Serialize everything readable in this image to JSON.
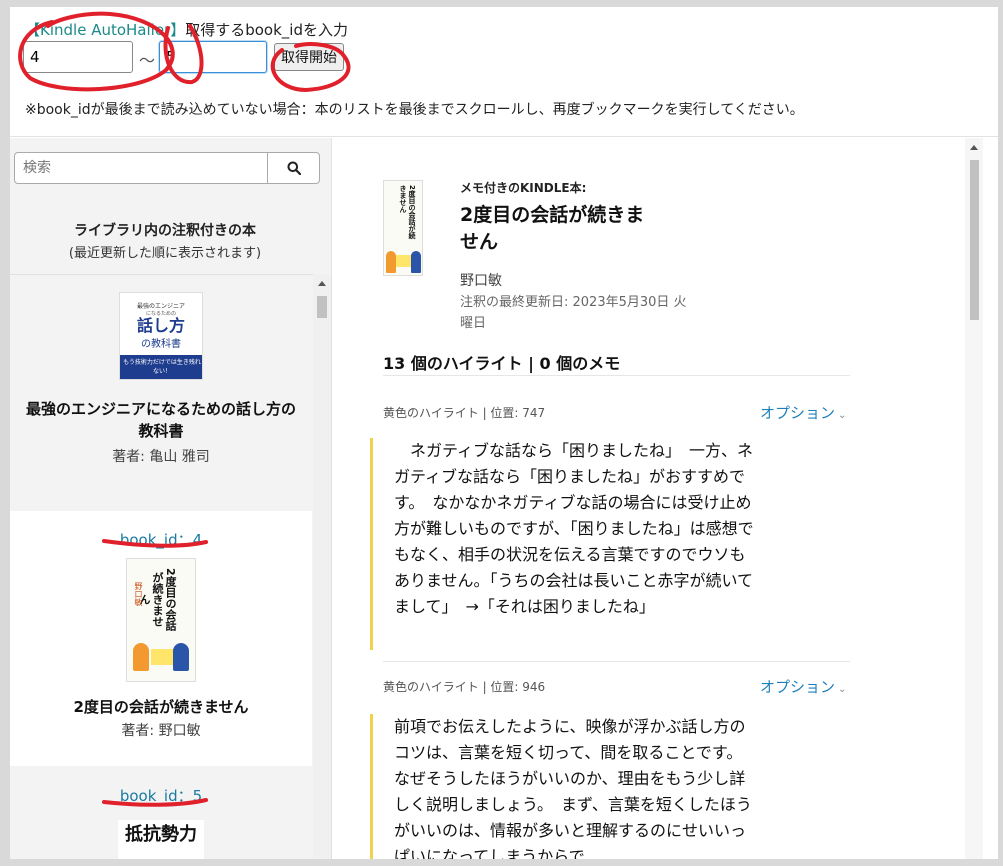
{
  "top": {
    "app_name": "【Kindle AutoHailer】",
    "prompt": "取得するbook_idを入力",
    "from_value": "4",
    "separator": "〜",
    "to_value": "5",
    "start_button": "取得開始",
    "note": "※book_idが最後まで読み込めていない場合：本のリストを最後までスクロールし、再度ブックマークを実行してください。"
  },
  "sidebar": {
    "search_placeholder": "検索",
    "heading": "ライブラリ内の注釈付きの本",
    "subheading": "(最近更新した順に表示されます)",
    "books": [
      {
        "title": "最強のエンジニアになるための話し方の教科書",
        "author": "著者: 亀山 雅司",
        "cover": {
          "kicker": "最強のエンジニア",
          "kicker2": "になるための",
          "main": "話し方",
          "sub": "の教科書",
          "band": "もう技術力だけでは生き残れない！"
        }
      },
      {
        "book_id": "book_id：4",
        "title": "2度目の会話が続きません",
        "author": "著者: 野口敏",
        "cover": {
          "main": "2度目の会話が続きません",
          "author": "野口敏"
        }
      },
      {
        "book_id": "book_id：5",
        "cover": {
          "main": "抵抗勢力"
        }
      }
    ]
  },
  "detail": {
    "label": "メモ付きのKINDLE本:",
    "title": "2度目の会話が続きません",
    "author": "野口敏",
    "updated": "注釈の最終更新日:  2023年5月30日 火曜日",
    "counts": "13 個のハイライト |   0 個のメモ",
    "highlights": [
      {
        "meta": "黄色のハイライト | 位置: 747",
        "option": "オプション",
        "text": "　ネガティブな話なら「困りましたね」　一方、ネガティブな話なら「困りましたね」がおすすめです。　なかなかネガティブな話の場合には受け止め方が難しいものですが、「困りましたね」は感想でもなく、相手の状況を伝える言葉ですのでウソもありません。「うちの会社は長いこと赤字が続いてまして」　→「それは困りましたね」"
      },
      {
        "meta": "黄色のハイライト | 位置: 946",
        "option": "オプション",
        "text": "前項でお伝えしたように、映像が浮かぶ話し方のコツは、言葉を短く切って、間を取ることです。　なぜそうしたほうがいいのか、理由をもう少し詳しく説明しましょう。　まず、言葉を短くしたほうがいいのは、情報が多いと理解するのにせいいっぱいになってしまうからで"
      }
    ]
  },
  "colors": {
    "accent_link": "#1d7fb8",
    "highlight_bar": "#f2d14c",
    "annotation_red": "#e0202a"
  }
}
